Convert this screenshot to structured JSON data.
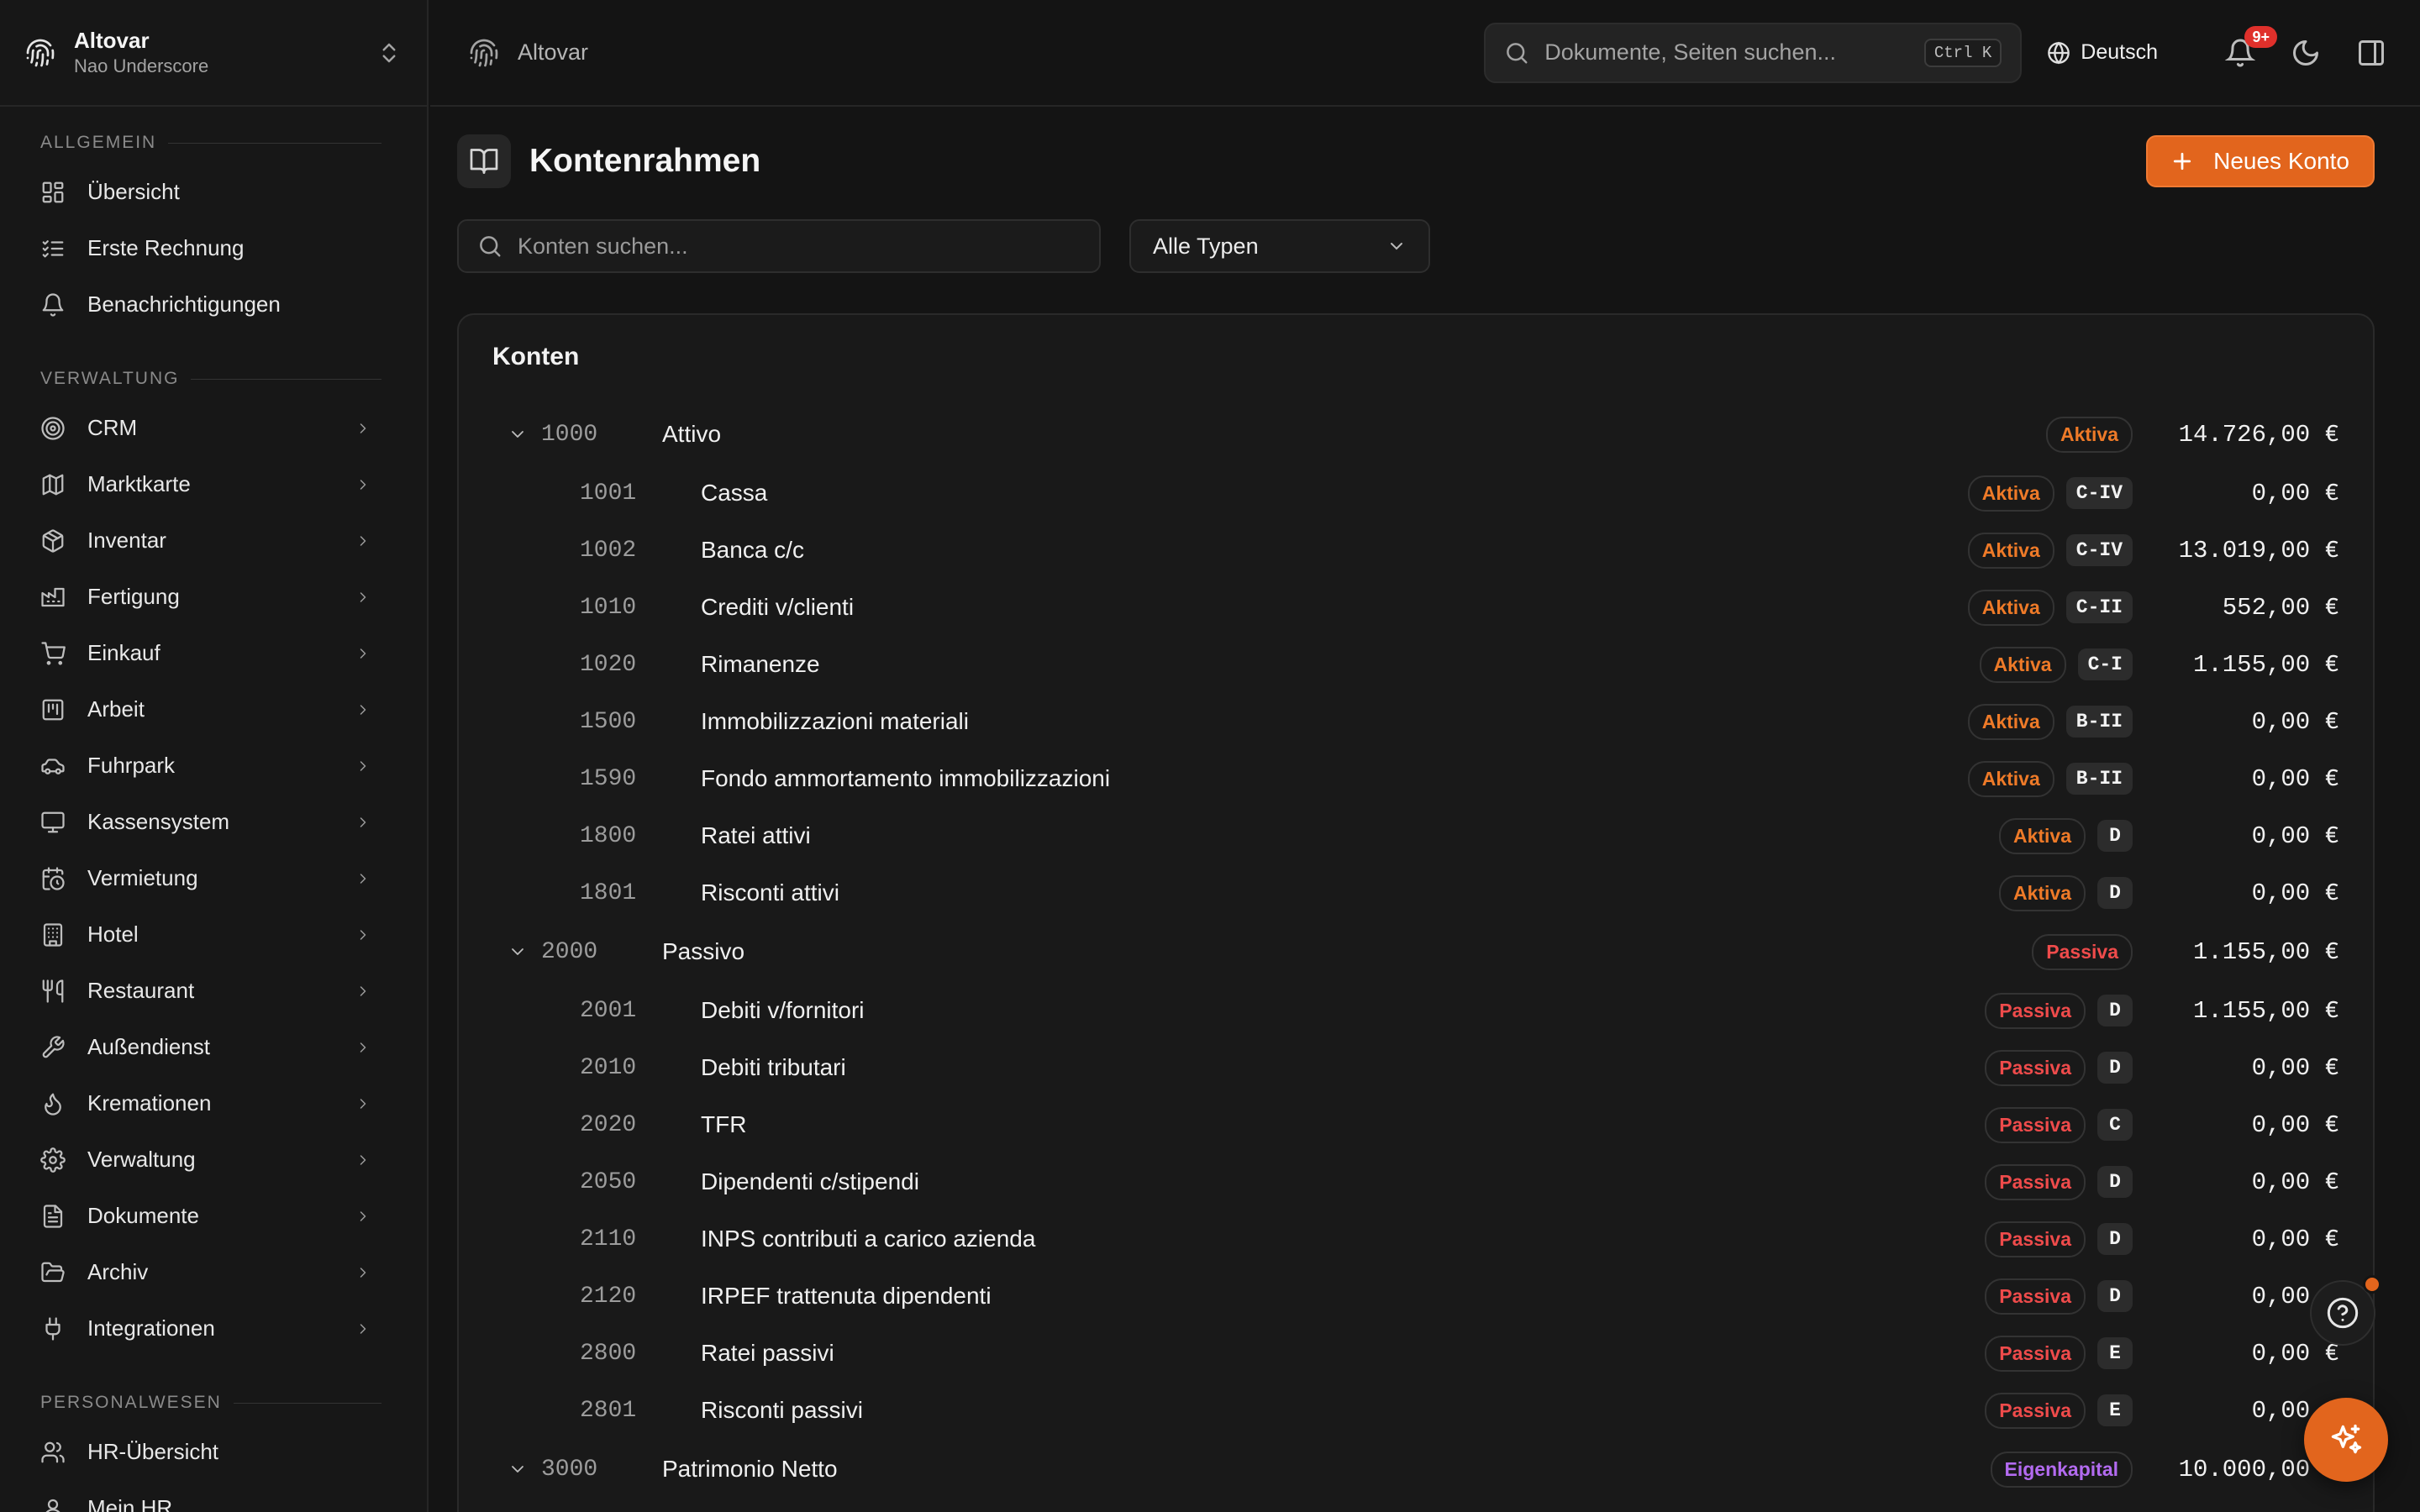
{
  "brand": {
    "name": "Altovar",
    "user": "Nao Underscore"
  },
  "sidebar": {
    "sections": [
      {
        "title": "ALLGEMEIN",
        "items": [
          {
            "label": "Übersicht",
            "icon": "dashboard-icon"
          },
          {
            "label": "Erste Rechnung",
            "icon": "list-check-icon"
          },
          {
            "label": "Benachrichtigungen",
            "icon": "bell-icon"
          }
        ]
      },
      {
        "title": "VERWALTUNG",
        "items": [
          {
            "label": "CRM",
            "icon": "target-icon"
          },
          {
            "label": "Marktkarte",
            "icon": "map-icon"
          },
          {
            "label": "Inventar",
            "icon": "package-icon"
          },
          {
            "label": "Fertigung",
            "icon": "factory-icon"
          },
          {
            "label": "Einkauf",
            "icon": "cart-icon"
          },
          {
            "label": "Arbeit",
            "icon": "kanban-icon"
          },
          {
            "label": "Fuhrpark",
            "icon": "car-icon"
          },
          {
            "label": "Kassensystem",
            "icon": "monitor-icon"
          },
          {
            "label": "Vermietung",
            "icon": "calendar-clock-icon"
          },
          {
            "label": "Hotel",
            "icon": "building-icon"
          },
          {
            "label": "Restaurant",
            "icon": "utensils-icon"
          },
          {
            "label": "Außendienst",
            "icon": "wrench-icon"
          },
          {
            "label": "Kremationen",
            "icon": "flame-icon"
          },
          {
            "label": "Verwaltung",
            "icon": "gear-icon"
          },
          {
            "label": "Dokumente",
            "icon": "file-icon"
          },
          {
            "label": "Archiv",
            "icon": "folder-open-icon"
          },
          {
            "label": "Integrationen",
            "icon": "plug-icon"
          }
        ]
      },
      {
        "title": "PERSONALWESEN",
        "items": [
          {
            "label": "HR-Übersicht",
            "icon": "users-icon"
          },
          {
            "label": "Mein HR",
            "icon": "user-icon"
          }
        ]
      }
    ]
  },
  "header": {
    "title": "Altovar",
    "search_placeholder": "Dokumente, Seiten suchen...",
    "shortcut": "Ctrl K",
    "language": "Deutsch",
    "notification_badge": "9+"
  },
  "page": {
    "title": "Kontenrahmen",
    "new_button": "Neues Konto",
    "filter_placeholder": "Konten suchen...",
    "type_select": "Alle Typen",
    "card_title": "Konten"
  },
  "accounts": [
    {
      "code": "1000",
      "name": "Attivo",
      "type": "Aktiva",
      "kind": "aktiva",
      "class": "",
      "amount": "14.726,00 €",
      "group": true
    },
    {
      "code": "1001",
      "name": "Cassa",
      "type": "Aktiva",
      "kind": "aktiva",
      "class": "C-IV",
      "amount": "0,00 €",
      "group": false
    },
    {
      "code": "1002",
      "name": "Banca c/c",
      "type": "Aktiva",
      "kind": "aktiva",
      "class": "C-IV",
      "amount": "13.019,00 €",
      "group": false
    },
    {
      "code": "1010",
      "name": "Crediti v/clienti",
      "type": "Aktiva",
      "kind": "aktiva",
      "class": "C-II",
      "amount": "552,00 €",
      "group": false
    },
    {
      "code": "1020",
      "name": "Rimanenze",
      "type": "Aktiva",
      "kind": "aktiva",
      "class": "C-I",
      "amount": "1.155,00 €",
      "group": false
    },
    {
      "code": "1500",
      "name": "Immobilizzazioni materiali",
      "type": "Aktiva",
      "kind": "aktiva",
      "class": "B-II",
      "amount": "0,00 €",
      "group": false
    },
    {
      "code": "1590",
      "name": "Fondo ammortamento immobilizzazioni",
      "type": "Aktiva",
      "kind": "aktiva",
      "class": "B-II",
      "amount": "0,00 €",
      "group": false
    },
    {
      "code": "1800",
      "name": "Ratei attivi",
      "type": "Aktiva",
      "kind": "aktiva",
      "class": "D",
      "amount": "0,00 €",
      "group": false
    },
    {
      "code": "1801",
      "name": "Risconti attivi",
      "type": "Aktiva",
      "kind": "aktiva",
      "class": "D",
      "amount": "0,00 €",
      "group": false
    },
    {
      "code": "2000",
      "name": "Passivo",
      "type": "Passiva",
      "kind": "passiva",
      "class": "",
      "amount": "1.155,00 €",
      "group": true
    },
    {
      "code": "2001",
      "name": "Debiti v/fornitori",
      "type": "Passiva",
      "kind": "passiva",
      "class": "D",
      "amount": "1.155,00 €",
      "group": false
    },
    {
      "code": "2010",
      "name": "Debiti tributari",
      "type": "Passiva",
      "kind": "passiva",
      "class": "D",
      "amount": "0,00 €",
      "group": false
    },
    {
      "code": "2020",
      "name": "TFR",
      "type": "Passiva",
      "kind": "passiva",
      "class": "C",
      "amount": "0,00 €",
      "group": false
    },
    {
      "code": "2050",
      "name": "Dipendenti c/stipendi",
      "type": "Passiva",
      "kind": "passiva",
      "class": "D",
      "amount": "0,00 €",
      "group": false
    },
    {
      "code": "2110",
      "name": "INPS contributi a carico azienda",
      "type": "Passiva",
      "kind": "passiva",
      "class": "D",
      "amount": "0,00 €",
      "group": false
    },
    {
      "code": "2120",
      "name": "IRPEF trattenuta dipendenti",
      "type": "Passiva",
      "kind": "passiva",
      "class": "D",
      "amount": "0,00 €",
      "group": false
    },
    {
      "code": "2800",
      "name": "Ratei passivi",
      "type": "Passiva",
      "kind": "passiva",
      "class": "E",
      "amount": "0,00 €",
      "group": false
    },
    {
      "code": "2801",
      "name": "Risconti passivi",
      "type": "Passiva",
      "kind": "passiva",
      "class": "E",
      "amount": "0,00 €",
      "group": false
    },
    {
      "code": "3000",
      "name": "Patrimonio Netto",
      "type": "Eigenkapital",
      "kind": "eigen",
      "class": "",
      "amount": "10.000,00 €",
      "group": true
    }
  ],
  "colors": {
    "accent": "#e2651d",
    "aktiva": "#ee7a28",
    "passiva": "#ef4b4b",
    "eigenkapital": "#b36bf0",
    "background": "#141414"
  }
}
